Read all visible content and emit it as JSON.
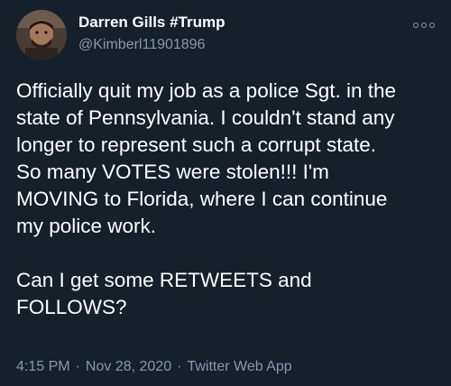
{
  "author": {
    "display_name": "Darren Gills #Trump",
    "handle": "@Kimberl11901896"
  },
  "icons": {
    "more": "more-options-icon",
    "avatar": "profile-photo"
  },
  "tweet": {
    "paragraph_1": "Officially quit my job as a police Sgt. in the\nstate of Pennsylvania. I couldn't stand any\nlonger to represent such a corrupt state.\nSo many VOTES were stolen!!! I'm\nMOVING to Florida, where I can continue\nmy police work.",
    "paragraph_2": "Can I get some RETWEETS and\nFOLLOWS?"
  },
  "meta": {
    "time": "4:15 PM",
    "separator": "·",
    "date": "Nov 28, 2020",
    "source": "Twitter Web App"
  },
  "colors": {
    "background": "#15202b",
    "text_primary": "#ffffff",
    "text_secondary": "#8899a6"
  }
}
